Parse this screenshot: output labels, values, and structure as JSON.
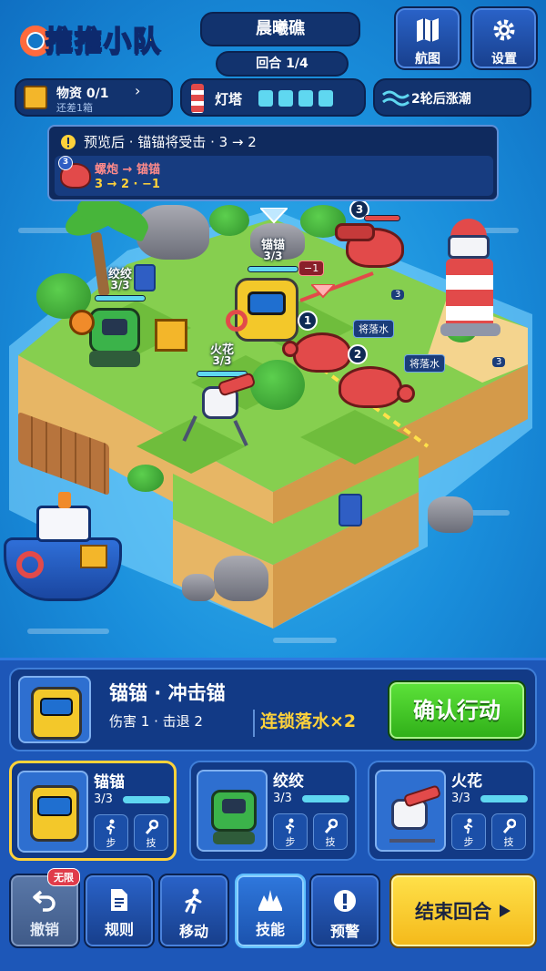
{
  "header": {
    "logo_text": "推推小队",
    "level_name": "晨曦礁",
    "round": "回合 1/4",
    "map_label": "航图",
    "settings_label": "设置"
  },
  "status": {
    "supplies_label": "物资 0/1",
    "supplies_arrow": "›",
    "supplies_sub": "还差1箱",
    "lighthouse_label": "灯塔",
    "lighthouse_pips_filled": 4,
    "tide_label": "2轮后涨潮"
  },
  "preview": {
    "headline": "预览后 · 锚锚将受击 · 3 → 2",
    "attacker_badge": "3",
    "attack_line": "螺炮 → 锚锚",
    "attack_detail": "3 → 2 · −1"
  },
  "board": {
    "units": [
      {
        "name": "锚锚",
        "hp": "3/3"
      },
      {
        "name": "绞绞",
        "hp": "3/3"
      },
      {
        "name": "火花",
        "hp": "3/3"
      }
    ],
    "enemy_top_num": "3",
    "damage_tag": "−1",
    "crab1_num": "1",
    "crab2_num": "2",
    "fall_tag_1": "将落水",
    "fall_tag_2": "将落水",
    "side_num_a": "3",
    "side_num_b": "3"
  },
  "action": {
    "title": "锚锚 · 冲击锚",
    "stats": "伤害 1 · 击退 2",
    "combo": "连锁落水×2",
    "confirm_label": "确认行动"
  },
  "roster": [
    {
      "name": "锚锚",
      "hp": "3/3",
      "step": "步",
      "skill": "技",
      "selected": true
    },
    {
      "name": "绞绞",
      "hp": "3/3",
      "step": "步",
      "skill": "技",
      "selected": false
    },
    {
      "name": "火花",
      "hp": "3/3",
      "step": "步",
      "skill": "技",
      "selected": false
    }
  ],
  "toolbar": {
    "undo_label": "撤销",
    "undo_badge": "无限",
    "rules_label": "规则",
    "move_label": "移动",
    "skill_label": "技能",
    "warning_label": "预警",
    "end_turn_label": "结束回合"
  },
  "colors": {
    "accent_yellow": "#ffd23a",
    "confirm_green": "#3fc423",
    "panel_blue": "#1d57b8",
    "combo_text": "#ffd23a",
    "enemy_red": "#e24a4a"
  }
}
